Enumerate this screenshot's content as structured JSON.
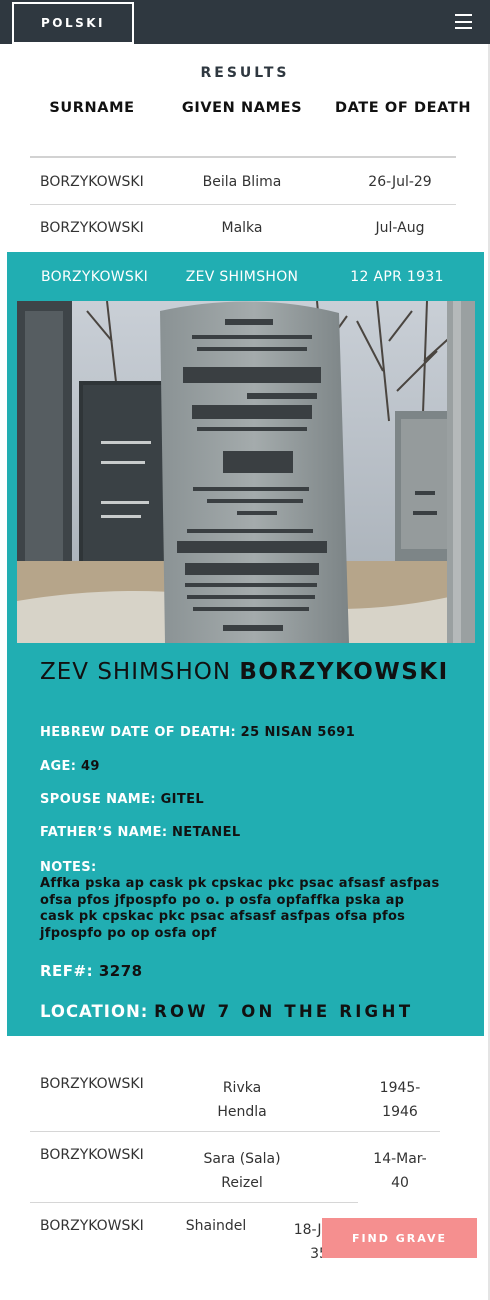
{
  "nav": {
    "language_label": "POLSKI",
    "menu_icon": "hamburger-menu-icon"
  },
  "results": {
    "title": "RESULTS",
    "headers": {
      "surname": "SURNAME",
      "given_names": "GIVEN NAMES",
      "date_of_death": "DATE OF DEATH"
    },
    "rows": [
      {
        "surname": "BORZYKOWSKI",
        "given": "Beila Blima",
        "dod": "26-Jul-29"
      },
      {
        "surname": "BORZYKOWSKI",
        "given": "Malka",
        "dod": "Jul-Aug"
      },
      {
        "surname": "BORZYKOWSKI",
        "given": "ZEV SHIMSHON",
        "dod": "12 APR 1931"
      },
      {
        "surname": "BORZYKOWSKI",
        "given_line1": "Rivka",
        "given_line2": "Hendla",
        "dod_line1": "1945-",
        "dod_line2": "1946"
      },
      {
        "surname": "BORZYKOWSKI",
        "given_line1": "Sara (Sala)",
        "given_line2": "Reizel",
        "dod_line1": "14-Mar-",
        "dod_line2": "40"
      },
      {
        "surname": "BORZYKOWSKI",
        "given": "Shaindel",
        "dod_line1": "18-Jun-",
        "dod_line2": "35",
        "extra": "undefined"
      }
    ]
  },
  "detail": {
    "first_names": "ZEV SHIMSHON",
    "surname": "BORZYKOWSKI",
    "hebrew_date_label": "HEBREW DATE OF DEATH:",
    "hebrew_date_value": "25 NISAN 5691",
    "age_label": "AGE:",
    "age_value": "49",
    "spouse_label": "SPOUSE NAME:",
    "spouse_value": "GITEL",
    "father_label": "FATHER’S NAME:",
    "father_value": "NETANEL",
    "notes_label": "NOTES:",
    "notes_value": "Affka pska ap cask pk cpskac pkc  psac afsasf asfpas ofsa pfos jfpospfo po o. p osfa opfaffka pska ap cask pk cpskac pkc  psac afsasf asfpas ofsa pfos jfpospfo po op osfa opf",
    "ref_label": "REF#:",
    "ref_value": "3278",
    "location_label": "LOCATION:",
    "location_value_a": "ROW 7 ON THE RI",
    "location_value_b": "GHT"
  },
  "actions": {
    "find_grave": "FIND GRAVE"
  },
  "colors": {
    "teal": "#21aeb2",
    "nav": "#2f3840",
    "button": "#f58f8f"
  }
}
